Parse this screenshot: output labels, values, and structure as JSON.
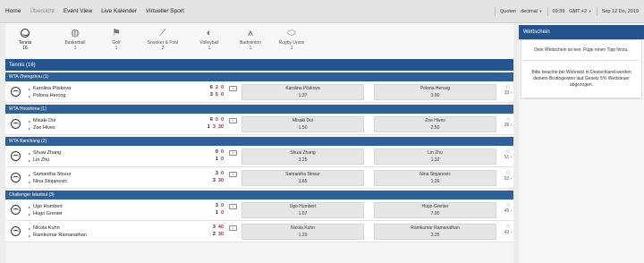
{
  "topnav": {
    "items": [
      "Home",
      "Übersicht",
      "Event View",
      "Live Kalender",
      "Virtueller Sport"
    ],
    "inactive_index": 1
  },
  "topright": {
    "odds_format_label": "Quoten",
    "odds_format_value": "decimal",
    "time": "09:39",
    "timezone": "GMT +2",
    "date": "Sep 12 Do, 2019"
  },
  "sports": [
    {
      "name": "Tennis",
      "count": "16",
      "icon": "tennis-ball-icon"
    },
    {
      "name": "Basketball",
      "count": "1",
      "icon": "basketball-icon"
    },
    {
      "name": "Golf",
      "count": "1",
      "icon": "golf-icon"
    },
    {
      "name": "Snooker & Pool",
      "count": "2",
      "icon": "snooker-icon"
    },
    {
      "name": "Volleyball",
      "count": "1",
      "icon": "volleyball-icon"
    },
    {
      "name": "Badminton",
      "count": "1",
      "icon": "badminton-icon"
    },
    {
      "name": "Rugby Union",
      "count": "1",
      "icon": "rugby-icon"
    }
  ],
  "section": {
    "title": "Tennis (16)"
  },
  "leagues": [
    {
      "title": "WTA Zhengzhou (1)",
      "matches": [
        {
          "p1": "Karolina Pliskova",
          "p2": "Polona Hercog",
          "s1": [
            "6",
            "2",
            "0"
          ],
          "s2": [
            "3",
            "5",
            "0"
          ],
          "o1_name": "Karolina Pliskova",
          "o1_val": "1.37",
          "o2_name": "Polona Hercog",
          "o2_val": "3.00",
          "more": "33"
        }
      ]
    },
    {
      "title": "WTA Hiroshima (1)",
      "matches": [
        {
          "p1": "Misaki Doi",
          "p2": "Zoe Hives",
          "s1": [
            "6",
            "0",
            "0"
          ],
          "s2": [
            "1",
            "3",
            "30"
          ],
          "o1_name": "Misaki Doi",
          "o1_val": "1.50",
          "o2_name": "Zoe Hives",
          "o2_val": "2.50",
          "more": "36"
        }
      ]
    },
    {
      "title": "WTA Nanchang (2)",
      "matches": [
        {
          "p1": "Shuai Zhang",
          "p2": "Lin Zhu",
          "s1": [
            "0",
            "0",
            ""
          ],
          "s2": [
            "1",
            "0",
            ""
          ],
          "o1_name": "Shuai Zhang",
          "o1_val": "3.25",
          "o2_name": "Lin Zhu",
          "o2_val": "1.32",
          "more": "51"
        },
        {
          "p1": "Samantha Stosur",
          "p2": "Nina Stojanovic",
          "s1": [
            "3",
            "0",
            ""
          ],
          "s2": [
            "3",
            "30",
            ""
          ],
          "o1_name": "Samantha Stosur",
          "o1_val": "3.65",
          "o2_name": "Nina Stojanovic",
          "o2_val": "1.26",
          "more": "52"
        }
      ]
    },
    {
      "title": "Challenger Istanbul (3)",
      "matches": [
        {
          "p1": "Ugo Humbert",
          "p2": "Hugo Grenier",
          "s1": [
            "3",
            "0",
            ""
          ],
          "s2": [
            "1",
            "0",
            ""
          ],
          "o1_name": "Ugo Humbert",
          "o1_val": "1.07",
          "o2_name": "Hugo Grenier",
          "o2_val": "7.00",
          "more": "45"
        },
        {
          "p1": "Nicola Kuhn",
          "p2": "Ramkumar Ramanathan",
          "s1": [
            "3",
            "40",
            ""
          ],
          "s2": [
            "2",
            "30",
            ""
          ],
          "o1_name": "Nicola Kuhn",
          "o1_val": "1.29",
          "o2_name": "Ramkumar Ramanathan",
          "o2_val": "3.25",
          "more": "43"
        }
      ]
    }
  ],
  "betslip": {
    "title": "Wettschein",
    "empty_text": "Dein Wettschein ist leer. Füge einen Tipp hinzu.",
    "note": "Bitte beachte bei Wohnsitz in Deutschland werden deinem Bruttogewinn laut Gesetz 5% Wettsteuer abgezogen."
  },
  "colors": {
    "header_blue": "#24548e",
    "score_red": "#c81e1e"
  }
}
